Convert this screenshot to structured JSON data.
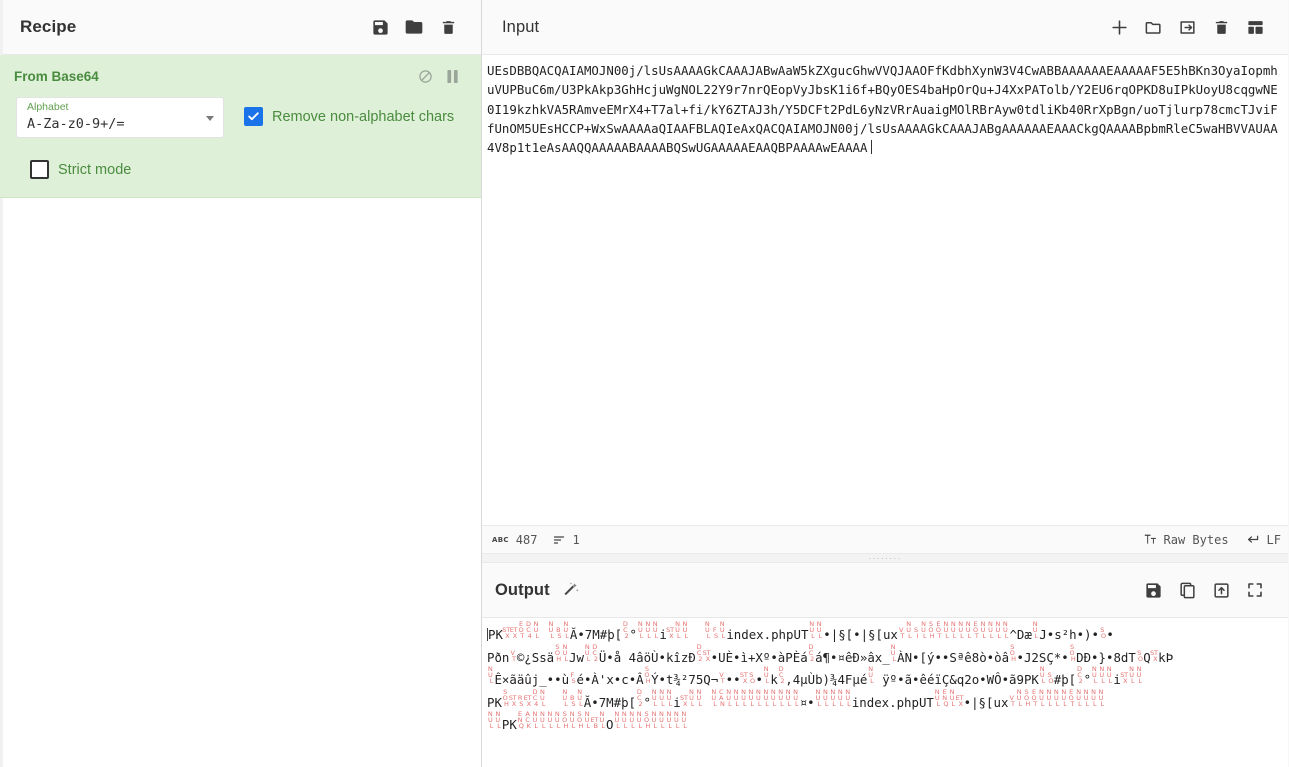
{
  "recipe": {
    "title": "Recipe",
    "icons": [
      {
        "name": "save-recipe-icon",
        "label": "Save recipe"
      },
      {
        "name": "load-recipe-icon",
        "label": "Load recipe"
      },
      {
        "name": "clear-recipe-icon",
        "label": "Clear recipe"
      }
    ],
    "operations": [
      {
        "name": "From Base64",
        "disable_label": "Disable operation",
        "breakpoint_label": "Set breakpoint",
        "args": {
          "alphabet_label": "Alphabet",
          "alphabet_value": "A-Za-z0-9+/=",
          "remove_non_alphabet_label": "Remove non-alphabet chars",
          "remove_non_alphabet_checked": true,
          "strict_mode_label": "Strict mode",
          "strict_mode_checked": false
        }
      }
    ]
  },
  "input": {
    "title": "Input",
    "icons": [
      {
        "name": "add-input-tab-icon",
        "label": "Add a new input tab"
      },
      {
        "name": "open-folder-icon",
        "label": "Open folder as input"
      },
      {
        "name": "open-file-icon",
        "label": "Open file as input"
      },
      {
        "name": "clear-input-icon",
        "label": "Clear input and output"
      },
      {
        "name": "reset-pane-layout-icon",
        "label": "Reset pane layout"
      }
    ],
    "text": "UEsDBBQACQAIAMOJN00j/lsUsAAAAGkCAAAJABwAaW5kZXgucGhwVVQJAAOFfKdbhXynW3V4CwABBAAAAAAEAAAAAF5E5hBKn3OyaIopmhuVUPBuC6m/U3PkAkp3GhHcjuWgNOL22Y9r7nrQEopVyJbsK1i6f+BQyOES4baHpOrQu+J4XxPATolb/Y2EU6rqOPKD8uIPkUoyU8cqgwNE0I19kzhkVA5RAmveEMrX4+T7al+fi/kY6ZTAJ3h/Y5DCFt2PdL6yNzVRrAuaigMOlRBrAyw0tdliKb40RrXpBgn/uoTjlurp78cmcTJviFfUnOM5UEsHCCP+WxSwAAAAaQIAAFBLAQIeAxQACQAIAMOJN00j/lsUsAAAAGkCAAAJABgAAAAAAEAAACkgQAAAABpbmRleC5waHBVVAUAA4V8p1t1eAsAAQQAAAAABAAAABQSwUGAAAAAEAAQBPAAAAwEAAAA",
    "caret": true,
    "status": {
      "length_icon": "character-count-icon",
      "length": "487",
      "lines_icon": "line-count-icon",
      "lines": "1",
      "encoding_icon": "text-format-icon",
      "encoding": "Raw Bytes",
      "line_ending_icon": "line-ending-icon",
      "line_ending": "LF"
    }
  },
  "output": {
    "title": "Output",
    "magic_icon": "magic-wand-icon",
    "icons": [
      {
        "name": "save-output-icon",
        "label": "Save output to file"
      },
      {
        "name": "copy-output-icon",
        "label": "Copy raw output to the clipboard"
      },
      {
        "name": "replace-input-icon",
        "label": "Replace input with output"
      },
      {
        "name": "maximise-output-icon",
        "label": "Maximise output pane"
      }
    ],
    "lines": [
      [
        {
          "t": "caret"
        },
        {
          "t": "txt",
          "v": "PK"
        },
        {
          "t": "cc",
          "v": "STX"
        },
        {
          "t": "cc",
          "v": "ETX"
        },
        {
          "t": "cc",
          "v": "EOT"
        },
        {
          "t": "cc",
          "v": "DC4"
        },
        {
          "t": "cc",
          "v": "NUL"
        },
        {
          "t": "txt",
          "v": " "
        },
        {
          "t": "cc",
          "v": "NUL"
        },
        {
          "t": "cc",
          "v": "BS"
        },
        {
          "t": "cc",
          "v": "NUL"
        },
        {
          "t": "txt",
          "v": "Ă•7M#þ["
        },
        {
          "t": "cc",
          "v": "DC2"
        },
        {
          "t": "txt",
          "v": "°"
        },
        {
          "t": "cc",
          "v": "NUL"
        },
        {
          "t": "cc",
          "v": "NUL"
        },
        {
          "t": "cc",
          "v": "NUL"
        },
        {
          "t": "txt",
          "v": "i"
        },
        {
          "t": "cc",
          "v": "STX"
        },
        {
          "t": "cc",
          "v": "NUL"
        },
        {
          "t": "cc",
          "v": "NUL"
        },
        {
          "t": "txt",
          "v": "  "
        },
        {
          "t": "cc",
          "v": "NUL"
        },
        {
          "t": "cc",
          "v": "FS"
        },
        {
          "t": "cc",
          "v": "NUL"
        },
        {
          "t": "txt",
          "v": "index.phpUT"
        },
        {
          "t": "cc",
          "v": "NUL"
        },
        {
          "t": "cc",
          "v": "NUL"
        },
        {
          "t": "txt",
          "v": "•|§[•|§[ux"
        },
        {
          "t": "cc",
          "v": "VT"
        },
        {
          "t": "cc",
          "v": "NUL"
        },
        {
          "t": "cc",
          "v": "SI"
        },
        {
          "t": "cc",
          "v": "NUL"
        },
        {
          "t": "cc",
          "v": "SOH"
        },
        {
          "t": "cc",
          "v": "EOT"
        },
        {
          "t": "cc",
          "v": "NUL"
        },
        {
          "t": "cc",
          "v": "NUL"
        },
        {
          "t": "cc",
          "v": "NUL"
        },
        {
          "t": "cc",
          "v": "NUL"
        },
        {
          "t": "cc",
          "v": "EOT"
        },
        {
          "t": "cc",
          "v": "NUL"
        },
        {
          "t": "cc",
          "v": "NUL"
        },
        {
          "t": "cc",
          "v": "NUL"
        },
        {
          "t": "cc",
          "v": "NUL"
        },
        {
          "t": "txt",
          "v": "^Dæ"
        },
        {
          "t": "cc",
          "v": "NUL"
        },
        {
          "t": "txt",
          "v": "J•s²h•)•"
        },
        {
          "t": "cc",
          "v": "SO"
        },
        {
          "t": "txt",
          "v": "•"
        }
      ],
      [
        {
          "t": "txt",
          "v": "Pðn"
        },
        {
          "t": "cc",
          "v": "VT"
        },
        {
          "t": "txt",
          "v": "©¿Ssä"
        },
        {
          "t": "cc",
          "v": "SOH"
        },
        {
          "t": "cc",
          "v": "NUL"
        },
        {
          "t": "txt",
          "v": "Jw"
        },
        {
          "t": "cc",
          "v": "NUL"
        },
        {
          "t": "cc",
          "v": "DC2"
        },
        {
          "t": "txt",
          "v": "Ü•å 4âöÙ•kîzÐ"
        },
        {
          "t": "cc",
          "v": "DC2"
        },
        {
          "t": "cc",
          "v": "STX"
        },
        {
          "t": "txt",
          "v": "•UÈ•ì+Xº•àPÈá"
        },
        {
          "t": "cc",
          "v": "DC2"
        },
        {
          "t": "txt",
          "v": "á¶•"
        },
        {
          "t": "txt",
          "v": "¤êÐ»âx_"
        },
        {
          "t": "cc",
          "v": "NUL"
        },
        {
          "t": "txt",
          "v": "ÀN•[ý••Sªê8ò•òâ"
        },
        {
          "t": "cc",
          "v": "SOH"
        },
        {
          "t": "txt",
          "v": "•J2SÇ*•"
        },
        {
          "t": "cc",
          "v": "SOH"
        },
        {
          "t": "txt",
          "v": "DÐ•}•8dT"
        },
        {
          "t": "cc",
          "v": "SO"
        },
        {
          "t": "txt",
          "v": "Q"
        },
        {
          "t": "cc",
          "v": "STX"
        },
        {
          "t": "txt",
          "v": "kÞ"
        }
      ],
      [
        {
          "t": "cc",
          "v": "NUL"
        },
        {
          "t": "txt",
          "v": "Ê×ãäûj_••ù"
        },
        {
          "t": "cc",
          "v": "FS"
        },
        {
          "t": "txt",
          "v": "é•À'x•c•Â"
        },
        {
          "t": "cc",
          "v": "SOH"
        },
        {
          "t": "txt",
          "v": "Ý•t¾²75Q¬"
        },
        {
          "t": "cc",
          "v": "VT"
        },
        {
          "t": "txt",
          "v": "••"
        },
        {
          "t": "cc",
          "v": "STX"
        },
        {
          "t": "cc",
          "v": "SO"
        },
        {
          "t": "txt",
          "v": "•"
        },
        {
          "t": "cc",
          "v": "NUL"
        },
        {
          "t": "txt",
          "v": "k"
        },
        {
          "t": "cc",
          "v": "DC2"
        },
        {
          "t": "txt",
          "v": ",4µÙb)¾4Fµé"
        },
        {
          "t": "cc",
          "v": "NUL"
        },
        {
          "t": "txt",
          "v": " ÿº•ã•êéïÇ&q2o•WÔ•ã9PK"
        },
        {
          "t": "cc",
          "v": "NUL"
        },
        {
          "t": "cc",
          "v": "SO"
        },
        {
          "t": "txt",
          "v": "#þ["
        },
        {
          "t": "cc",
          "v": "DC2"
        },
        {
          "t": "txt",
          "v": "°"
        },
        {
          "t": "cc",
          "v": "NUL"
        },
        {
          "t": "cc",
          "v": "NUL"
        },
        {
          "t": "cc",
          "v": "NUL"
        },
        {
          "t": "txt",
          "v": "i"
        },
        {
          "t": "cc",
          "v": "STX"
        },
        {
          "t": "cc",
          "v": "NUL"
        },
        {
          "t": "cc",
          "v": "NUL"
        }
      ],
      [
        {
          "t": "txt",
          "v": "PK"
        },
        {
          "t": "cc",
          "v": "SOH"
        },
        {
          "t": "cc",
          "v": "STX"
        },
        {
          "t": "cc",
          "v": "RS"
        },
        {
          "t": "cc",
          "v": "ETX"
        },
        {
          "t": "cc",
          "v": "DC4"
        },
        {
          "t": "cc",
          "v": "NUL"
        },
        {
          "t": "txt",
          "v": "  "
        },
        {
          "t": "cc",
          "v": "NUL"
        },
        {
          "t": "cc",
          "v": "BS"
        },
        {
          "t": "cc",
          "v": "NUL"
        },
        {
          "t": "txt",
          "v": "Ă•7M#þ["
        },
        {
          "t": "cc",
          "v": "DC2"
        },
        {
          "t": "txt",
          "v": "°"
        },
        {
          "t": "cc",
          "v": "NUL"
        },
        {
          "t": "cc",
          "v": "NUL"
        },
        {
          "t": "cc",
          "v": "NUL"
        },
        {
          "t": "txt",
          "v": "i"
        },
        {
          "t": "cc",
          "v": "STX"
        },
        {
          "t": "cc",
          "v": "NUL"
        },
        {
          "t": "cc",
          "v": "NUL"
        },
        {
          "t": "txt",
          "v": " "
        },
        {
          "t": "cc",
          "v": "NUL"
        },
        {
          "t": "cc",
          "v": "CAN"
        },
        {
          "t": "cc",
          "v": "NUL"
        },
        {
          "t": "cc",
          "v": "NUL"
        },
        {
          "t": "cc",
          "v": "NUL"
        },
        {
          "t": "cc",
          "v": "NUL"
        },
        {
          "t": "cc",
          "v": "NUL"
        },
        {
          "t": "cc",
          "v": "NUL"
        },
        {
          "t": "cc",
          "v": "NUL"
        },
        {
          "t": "cc",
          "v": "NUL"
        },
        {
          "t": "cc",
          "v": "NUL"
        },
        {
          "t": "cc",
          "v": "NUL"
        },
        {
          "t": "txt",
          "v": "¤•"
        },
        {
          "t": "cc",
          "v": "NUL"
        },
        {
          "t": "cc",
          "v": "NUL"
        },
        {
          "t": "cc",
          "v": "NUL"
        },
        {
          "t": "cc",
          "v": "NUL"
        },
        {
          "t": "cc",
          "v": "NUL"
        },
        {
          "t": "txt",
          "v": "index.phpUT"
        },
        {
          "t": "cc",
          "v": "NUL"
        },
        {
          "t": "cc",
          "v": "ENQ"
        },
        {
          "t": "cc",
          "v": "NUL"
        },
        {
          "t": "cc",
          "v": "ETX"
        },
        {
          "t": "txt",
          "v": "•|§[ux"
        },
        {
          "t": "cc",
          "v": "VT"
        },
        {
          "t": "cc",
          "v": "NUL"
        },
        {
          "t": "cc",
          "v": "SOH"
        },
        {
          "t": "cc",
          "v": "EOT"
        },
        {
          "t": "cc",
          "v": "NUL"
        },
        {
          "t": "cc",
          "v": "NUL"
        },
        {
          "t": "cc",
          "v": "NUL"
        },
        {
          "t": "cc",
          "v": "NUL"
        },
        {
          "t": "cc",
          "v": "EOT"
        },
        {
          "t": "cc",
          "v": "NUL"
        },
        {
          "t": "cc",
          "v": "NUL"
        },
        {
          "t": "cc",
          "v": "NUL"
        },
        {
          "t": "cc",
          "v": "NUL"
        }
      ],
      [
        {
          "t": "cc",
          "v": "NUL"
        },
        {
          "t": "cc",
          "v": "NUL"
        },
        {
          "t": "txt",
          "v": "PK"
        },
        {
          "t": "cc",
          "v": "ENQ"
        },
        {
          "t": "cc",
          "v": "ACK"
        },
        {
          "t": "cc",
          "v": "NUL"
        },
        {
          "t": "cc",
          "v": "NUL"
        },
        {
          "t": "cc",
          "v": "NUL"
        },
        {
          "t": "cc",
          "v": "NUL"
        },
        {
          "t": "cc",
          "v": "SOH"
        },
        {
          "t": "cc",
          "v": "NUL"
        },
        {
          "t": "cc",
          "v": "SOH"
        },
        {
          "t": "cc",
          "v": "NUL"
        },
        {
          "t": "cc",
          "v": "ETB"
        },
        {
          "t": "cc",
          "v": "NUL"
        },
        {
          "t": "txt",
          "v": "O"
        },
        {
          "t": "cc",
          "v": "NUL"
        },
        {
          "t": "cc",
          "v": "NUL"
        },
        {
          "t": "cc",
          "v": "NUL"
        },
        {
          "t": "cc",
          "v": "NUL"
        },
        {
          "t": "cc",
          "v": "SOH"
        },
        {
          "t": "cc",
          "v": "NUL"
        },
        {
          "t": "cc",
          "v": "NUL"
        },
        {
          "t": "cc",
          "v": "NUL"
        },
        {
          "t": "cc",
          "v": "NUL"
        },
        {
          "t": "cc",
          "v": "NUL"
        }
      ]
    ]
  },
  "colors": {
    "accent_green": "#4a8c3f",
    "op_background": "#dff0d8",
    "checkbox_blue": "#1a73e8",
    "control_char_red": "#e04a4a"
  }
}
